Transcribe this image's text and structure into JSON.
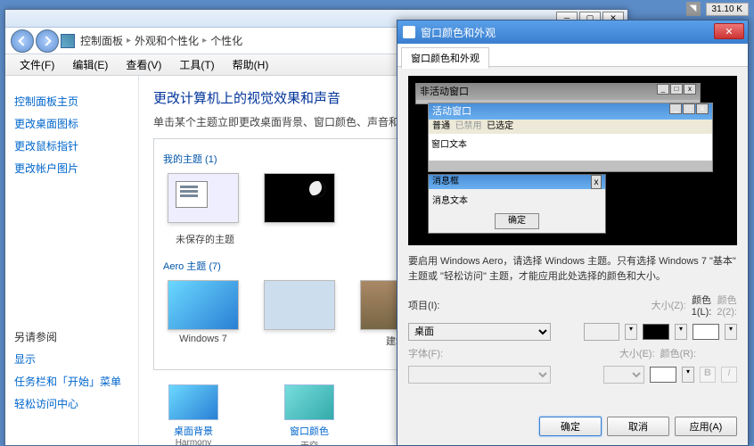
{
  "topbar": {
    "size": "31.10 K"
  },
  "cp": {
    "breadcrumb": [
      "控制面板",
      "外观和个性化",
      "个性化"
    ],
    "menus": {
      "file": "文件(F)",
      "edit": "编辑(E)",
      "view": "查看(V)",
      "tools": "工具(T)",
      "help": "帮助(H)"
    },
    "sidebar": {
      "home": "控制面板主页",
      "links": [
        "更改桌面图标",
        "更改鼠标指针",
        "更改帐户图片"
      ],
      "see_also": "另请参阅",
      "see_links": [
        "显示",
        "任务栏和「开始」菜单",
        "轻松访问中心"
      ]
    },
    "main": {
      "title": "更改计算机上的视觉效果和声音",
      "desc": "单击某个主题立即更改桌面背景、窗口颜色、声音和屏幕保",
      "my_themes": "我的主题 (1)",
      "unsaved": "未保存的主题",
      "aero_themes": "Aero 主题 (7)",
      "win7": "Windows 7",
      "arch": "建筑",
      "bg_label": "桌面背景",
      "bg_sub": "Harmony",
      "color_label": "窗口颜色",
      "color_sub": "天空"
    }
  },
  "dlg": {
    "title": "窗口颜色和外观",
    "tab": "窗口颜色和外观",
    "preview": {
      "inactive": "非活动窗口",
      "active": "活动窗口",
      "menu_normal": "普通",
      "menu_disabled": "已禁用",
      "menu_selected": "已选定",
      "body": "窗口文本",
      "msg_title": "消息框",
      "msg_body": "消息文本",
      "msg_ok": "确定"
    },
    "hint": "要启用 Windows Aero，请选择 Windows 主题。只有选择 Windows 7 \"基本\" 主题或 \"轻松访问\" 主题，才能应用此处选择的颜色和大小。",
    "form": {
      "item": "项目(I):",
      "item_value": "桌面",
      "size_l": "大小(Z):",
      "color1": "颜色\n1(L):",
      "color2": "颜色\n2(2):",
      "font": "字体(F):",
      "size_e": "大小(E):",
      "color_r": "颜色(R):"
    },
    "buttons": {
      "ok": "确定",
      "cancel": "取消",
      "apply": "应用(A)"
    }
  }
}
